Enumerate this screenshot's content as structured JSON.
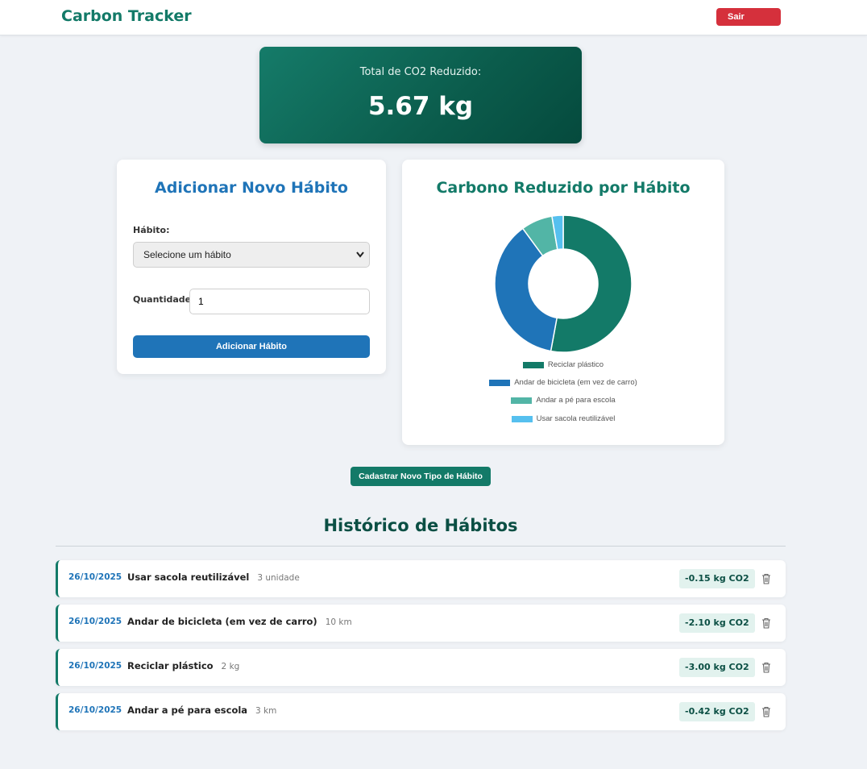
{
  "header": {
    "brand": "Carbon Tracker",
    "logout_label": "Sair"
  },
  "summary": {
    "label": "Total de CO2 Reduzido:",
    "value": "5.67 kg"
  },
  "form": {
    "title": "Adicionar Novo Hábito",
    "habit_label": "Hábito:",
    "habit_select": "Selecione um hábito",
    "quantity_label": "Quantidade:",
    "quantity_value": "1",
    "submit_label": "Adicionar Hábito"
  },
  "chart_panel": {
    "title": "Carbono Reduzido por Hábito"
  },
  "chart_data": {
    "type": "pie",
    "title": "Carbono Reduzido por Hábito",
    "categories": [
      "Reciclar plástico",
      "Andar de bicicleta (em vez de carro)",
      "Andar a pé para escola",
      "Usar sacola reutilizável"
    ],
    "values": [
      3.0,
      2.1,
      0.42,
      0.15
    ],
    "colors": [
      "#137a68",
      "#1f74b8",
      "#52b5a6",
      "#56c0ef"
    ],
    "donut": true,
    "legend": "bottom"
  },
  "register_label": "Cadastrar Novo Tipo de Hábito",
  "history": {
    "title": "Histórico de Hábitos",
    "rows": [
      {
        "date": "26/10/2025",
        "name": "Usar sacola reutilizável",
        "qty": "3 unidade",
        "co2": "-0.15 kg CO2"
      },
      {
        "date": "26/10/2025",
        "name": "Andar de bicicleta (em vez de carro)",
        "qty": "10 km",
        "co2": "-2.10 kg CO2"
      },
      {
        "date": "26/10/2025",
        "name": "Reciclar plástico",
        "qty": "2 kg",
        "co2": "-3.00 kg CO2"
      },
      {
        "date": "26/10/2025",
        "name": "Andar a pé para escola",
        "qty": "3 km",
        "co2": "-0.42 kg CO2"
      }
    ]
  },
  "icons": {
    "delete": "trash-icon",
    "select": "chevron-down-icon"
  }
}
